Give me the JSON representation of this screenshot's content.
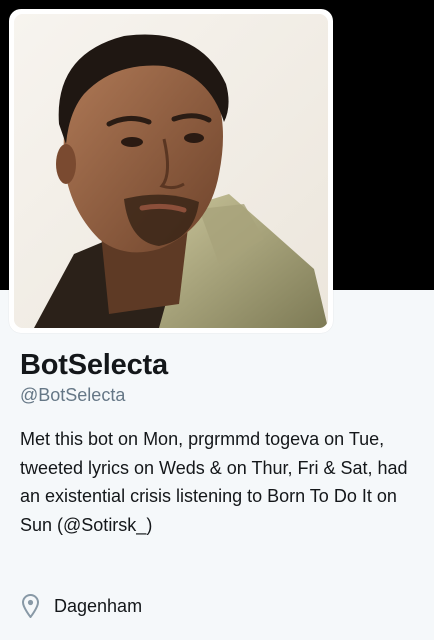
{
  "profile": {
    "display_name": "BotSelecta",
    "screen_name": "@BotSelecta",
    "bio": "Met this bot on Mon, prgrmmd togeva on Tue, tweeted lyrics on Weds & on Thur, Fri & Sat, had an existential crisis listening to Born To Do It on Sun (@Sotirsk_)",
    "location": "Dagenham",
    "location_icon": "location-pin-icon"
  },
  "colors": {
    "banner": "#000000",
    "background": "#f5f8fa",
    "name_text": "#14171a",
    "secondary_text": "#657786",
    "icon": "#8899a6"
  }
}
